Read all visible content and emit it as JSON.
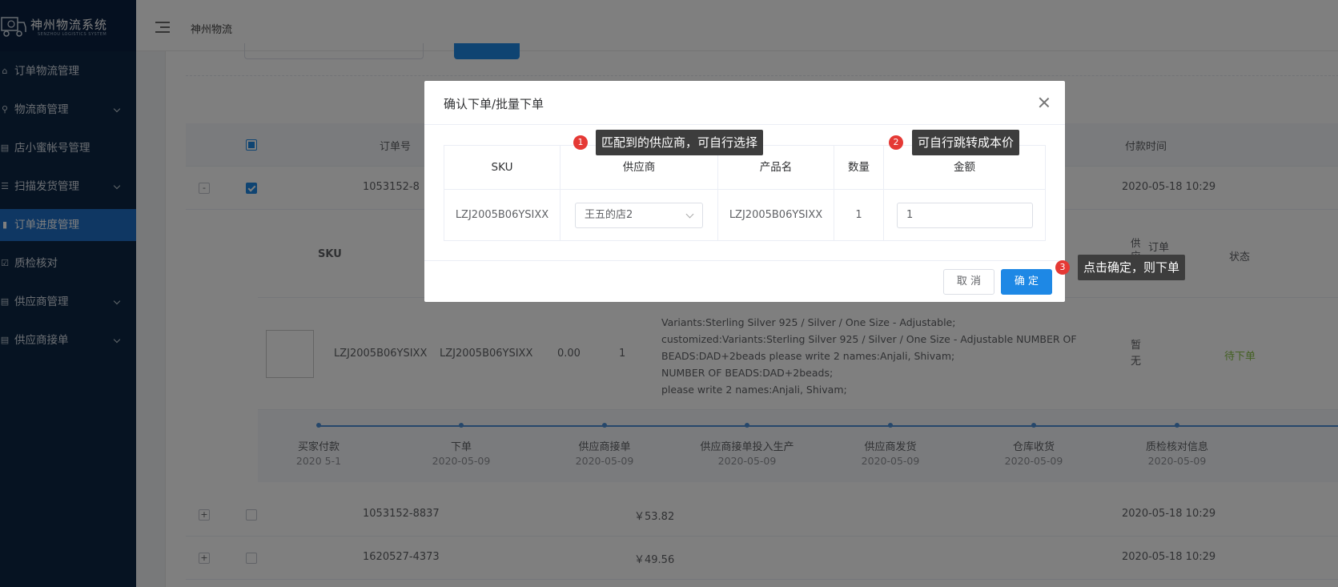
{
  "app": {
    "logo_name": "神州物流系统",
    "logo_sub": "SENZHOU LOGISTICS SYSTEM",
    "breadcrumb": "神州物流"
  },
  "sidebar": {
    "items": [
      {
        "label": "订单物流管理",
        "icon": "home-icon",
        "expandable": false,
        "active": false
      },
      {
        "label": "物流商管理",
        "icon": "search-icon",
        "expandable": true,
        "active": false
      },
      {
        "label": "店小蜜帐号管理",
        "icon": "grid-icon",
        "expandable": false,
        "active": false
      },
      {
        "label": "扫描发货管理",
        "icon": "list-icon",
        "expandable": true,
        "active": false
      },
      {
        "label": "订单进度管理",
        "icon": "bars-icon",
        "expandable": false,
        "active": true
      },
      {
        "label": "质检核对",
        "icon": "check-icon",
        "expandable": false,
        "active": false
      },
      {
        "label": "供应商管理",
        "icon": "grid-icon",
        "expandable": true,
        "active": false
      },
      {
        "label": "供应商接单",
        "icon": "grid-icon",
        "expandable": true,
        "active": false
      }
    ]
  },
  "table": {
    "headers": {
      "order_no": "订单号",
      "pay_time": "付款时间"
    },
    "rows": [
      {
        "expander": "-",
        "checked": true,
        "order_no": "1053152-8",
        "amount": "",
        "pay_time": "2020-05-18 10:29"
      },
      {
        "expander": "+",
        "checked": false,
        "order_no": "1053152-8837",
        "amount": "￥53.82",
        "pay_time": "2020-05-18 10:29"
      },
      {
        "expander": "+",
        "checked": false,
        "order_no": "1620527-4373",
        "amount": "￥49.56",
        "pay_time": "2020-05-18 10:29"
      }
    ]
  },
  "detail": {
    "headers": {
      "sku": "SKU",
      "supplier_short": "供应商",
      "remark": "订单备注",
      "status": "状态"
    },
    "item": {
      "sku": "LZJ2005B06YSIXX",
      "product": "LZJ2005B06YSIXX",
      "price": "0.00",
      "qty": "1",
      "variants": [
        "Variants:Sterling Silver 925 / Silver / One Size - Adjustable;",
        "customized:Variants:Sterling Silver 925 / Silver / One Size - Adjustable NUMBER OF BEADS:DAD+2beads please write 2 names:Anjali, Shivam;",
        "NUMBER OF BEADS:DAD+2beads;",
        "please write 2 names:Anjali, Shivam;"
      ],
      "supplier_short": "暂无",
      "status": "待下单"
    },
    "steps": [
      {
        "name": "买家付款",
        "date": "2020 5-1"
      },
      {
        "name": "下单",
        "date": "2020-05-09"
      },
      {
        "name": "供应商接单",
        "date": "2020-05-09"
      },
      {
        "name": "供应商接单投入生产",
        "date": "2020-05-09"
      },
      {
        "name": "供应商发货",
        "date": "2020-05-09"
      },
      {
        "name": "仓库收货",
        "date": "2020-05-09"
      },
      {
        "name": "质检核对信息",
        "date": "2020-05-09"
      }
    ]
  },
  "modal": {
    "title": "确认下单/批量下单",
    "columns": {
      "sku": "SKU",
      "supplier": "供应商",
      "product": "产品名",
      "qty": "数量",
      "amount": "金额"
    },
    "row": {
      "sku": "LZJ2005B06YSIXX",
      "supplier": "王五的店2",
      "product": "LZJ2005B06YSIXX",
      "qty": "1",
      "amount": "1"
    },
    "cancel": "取 消",
    "ok": "确 定"
  },
  "tips": [
    {
      "num": "1",
      "text": "匹配到的供应商，可自行选择"
    },
    {
      "num": "2",
      "text": "可自行跳转成本价"
    },
    {
      "num": "3",
      "text": "点击确定，则下单"
    }
  ],
  "colors": {
    "primary": "#1e88e5",
    "sidebar": "#0d2744",
    "active": "#1f6fc6",
    "status": "#8bc34a",
    "badge": "#e53935"
  }
}
